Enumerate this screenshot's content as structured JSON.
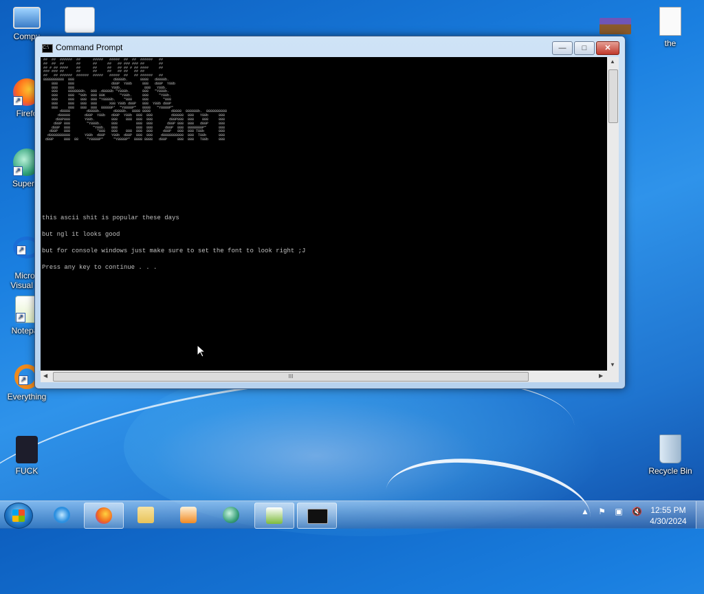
{
  "desktop": {
    "icons": [
      {
        "label": "Compu",
        "icon": "computer-icon"
      },
      {
        "label": "",
        "icon": "control-panel-icon"
      },
      {
        "label": "Firefo",
        "icon": "firefox-icon"
      },
      {
        "label": "Superm",
        "icon": "supermium-icon"
      },
      {
        "label": "Micros\nVisual St",
        "icon": "visual-studio-icon"
      },
      {
        "label": "Notepac",
        "icon": "notepad-plus-plus-icon"
      },
      {
        "label": "Everything",
        "icon": "everything-search-icon"
      },
      {
        "label": "FUCK",
        "icon": "firefox-file-icon"
      },
      {
        "label": "",
        "icon": "game-icon"
      },
      {
        "label": "the",
        "icon": "text-document-icon"
      },
      {
        "label": "Recycle Bin",
        "icon": "recycle-bin-icon"
      }
    ]
  },
  "window": {
    "title": "Command Prompt",
    "minimize_label": "—",
    "maximize_label": "□",
    "close_label": "✕",
    "hscroll_grip": "III",
    "ascii_art": "##  ##  ######  ##      #####   #####  ##  ##  ######   ##\n##  ##  ##      ##      ##     ##   ## ### ### ##       ##\n## # ## ####    ##      ##     ##   ## ## # ## ####     ##\n### ### ##      ##      ##     ##   ## ##   ## ##\n##   ## ######  ######  #####   #####  ##   ## ######   ##\n8888888888  888                   d8888b.      8888   d8888b.\n    888     888                  d88P  Y88b     888   d88P  Y88b\n    888     888                  Y88b.           888   Y88b.\n    888     8888888b.  888 .d8888b \"Y888b.      888   \"Y888b.\n    888     888  \"88b  888 88K       \"Y88b.     888     \"Y88b.\n    888     888   888  888 \"Y8888b.    \"888     888       \"888\n    888     888   888  888      X88 Y88b d88P   888  Y88b d88P\n    888     888   888  888  88888P'  \"Y8888P\"   8888   \"Y8888P\"\n        d8888        d8888b.      d8888b.  8888 8888          d8888  888888b.  8888888888\n       d88888       d88P  Y88b   d88P  Y88b  888  888         d88888  888   Y88b     888\n      d88P888       Y88b.        888    888  888  888        d88P888  888    888     888\n     d88P 888        \"Y888b.     888         888  888       d88P 888  888   d88P     888\n    d88P  888           \"Y88b.   888         888  888      d88P  888  8888888P\"      888\n   d88P   888             \"888   888    888  888  888     d88P   888  888 T88b       888\n  d8888888888       Y88b  d88P   Y88b  d88P  888  888    d8888888888  888  T88b      888\n d88P     888  88    \"Y8888P\"     \"Y8888P\"  8888 8888   d88P     888  888   T88b     888",
    "console_lines": [
      "this ascii shit is popular these days",
      "but ngl it looks good",
      "but for console windows just make sure to set the font to look right ;J",
      "Press any key to continue . . ."
    ]
  },
  "taskbar": {
    "items": [
      {
        "name": "internet-explorer",
        "color": "#2b8fe0",
        "active": false
      },
      {
        "name": "firefox",
        "color": "#f26b1d",
        "active": true
      },
      {
        "name": "file-explorer",
        "color": "#e8c35a",
        "active": false
      },
      {
        "name": "media-player",
        "color": "#f08a24",
        "active": false
      },
      {
        "name": "supermium",
        "color": "#3aa07a",
        "active": false
      },
      {
        "name": "notepad-plus-plus",
        "color": "#7dbb3c",
        "active": true
      },
      {
        "name": "command-prompt",
        "color": "#111111",
        "active": true
      }
    ],
    "tray_chevron": "▲",
    "tray_flag": "⚑",
    "tray_network": "▣",
    "tray_volume": "🔇",
    "time": "12:55 PM",
    "date": "4/30/2024"
  }
}
